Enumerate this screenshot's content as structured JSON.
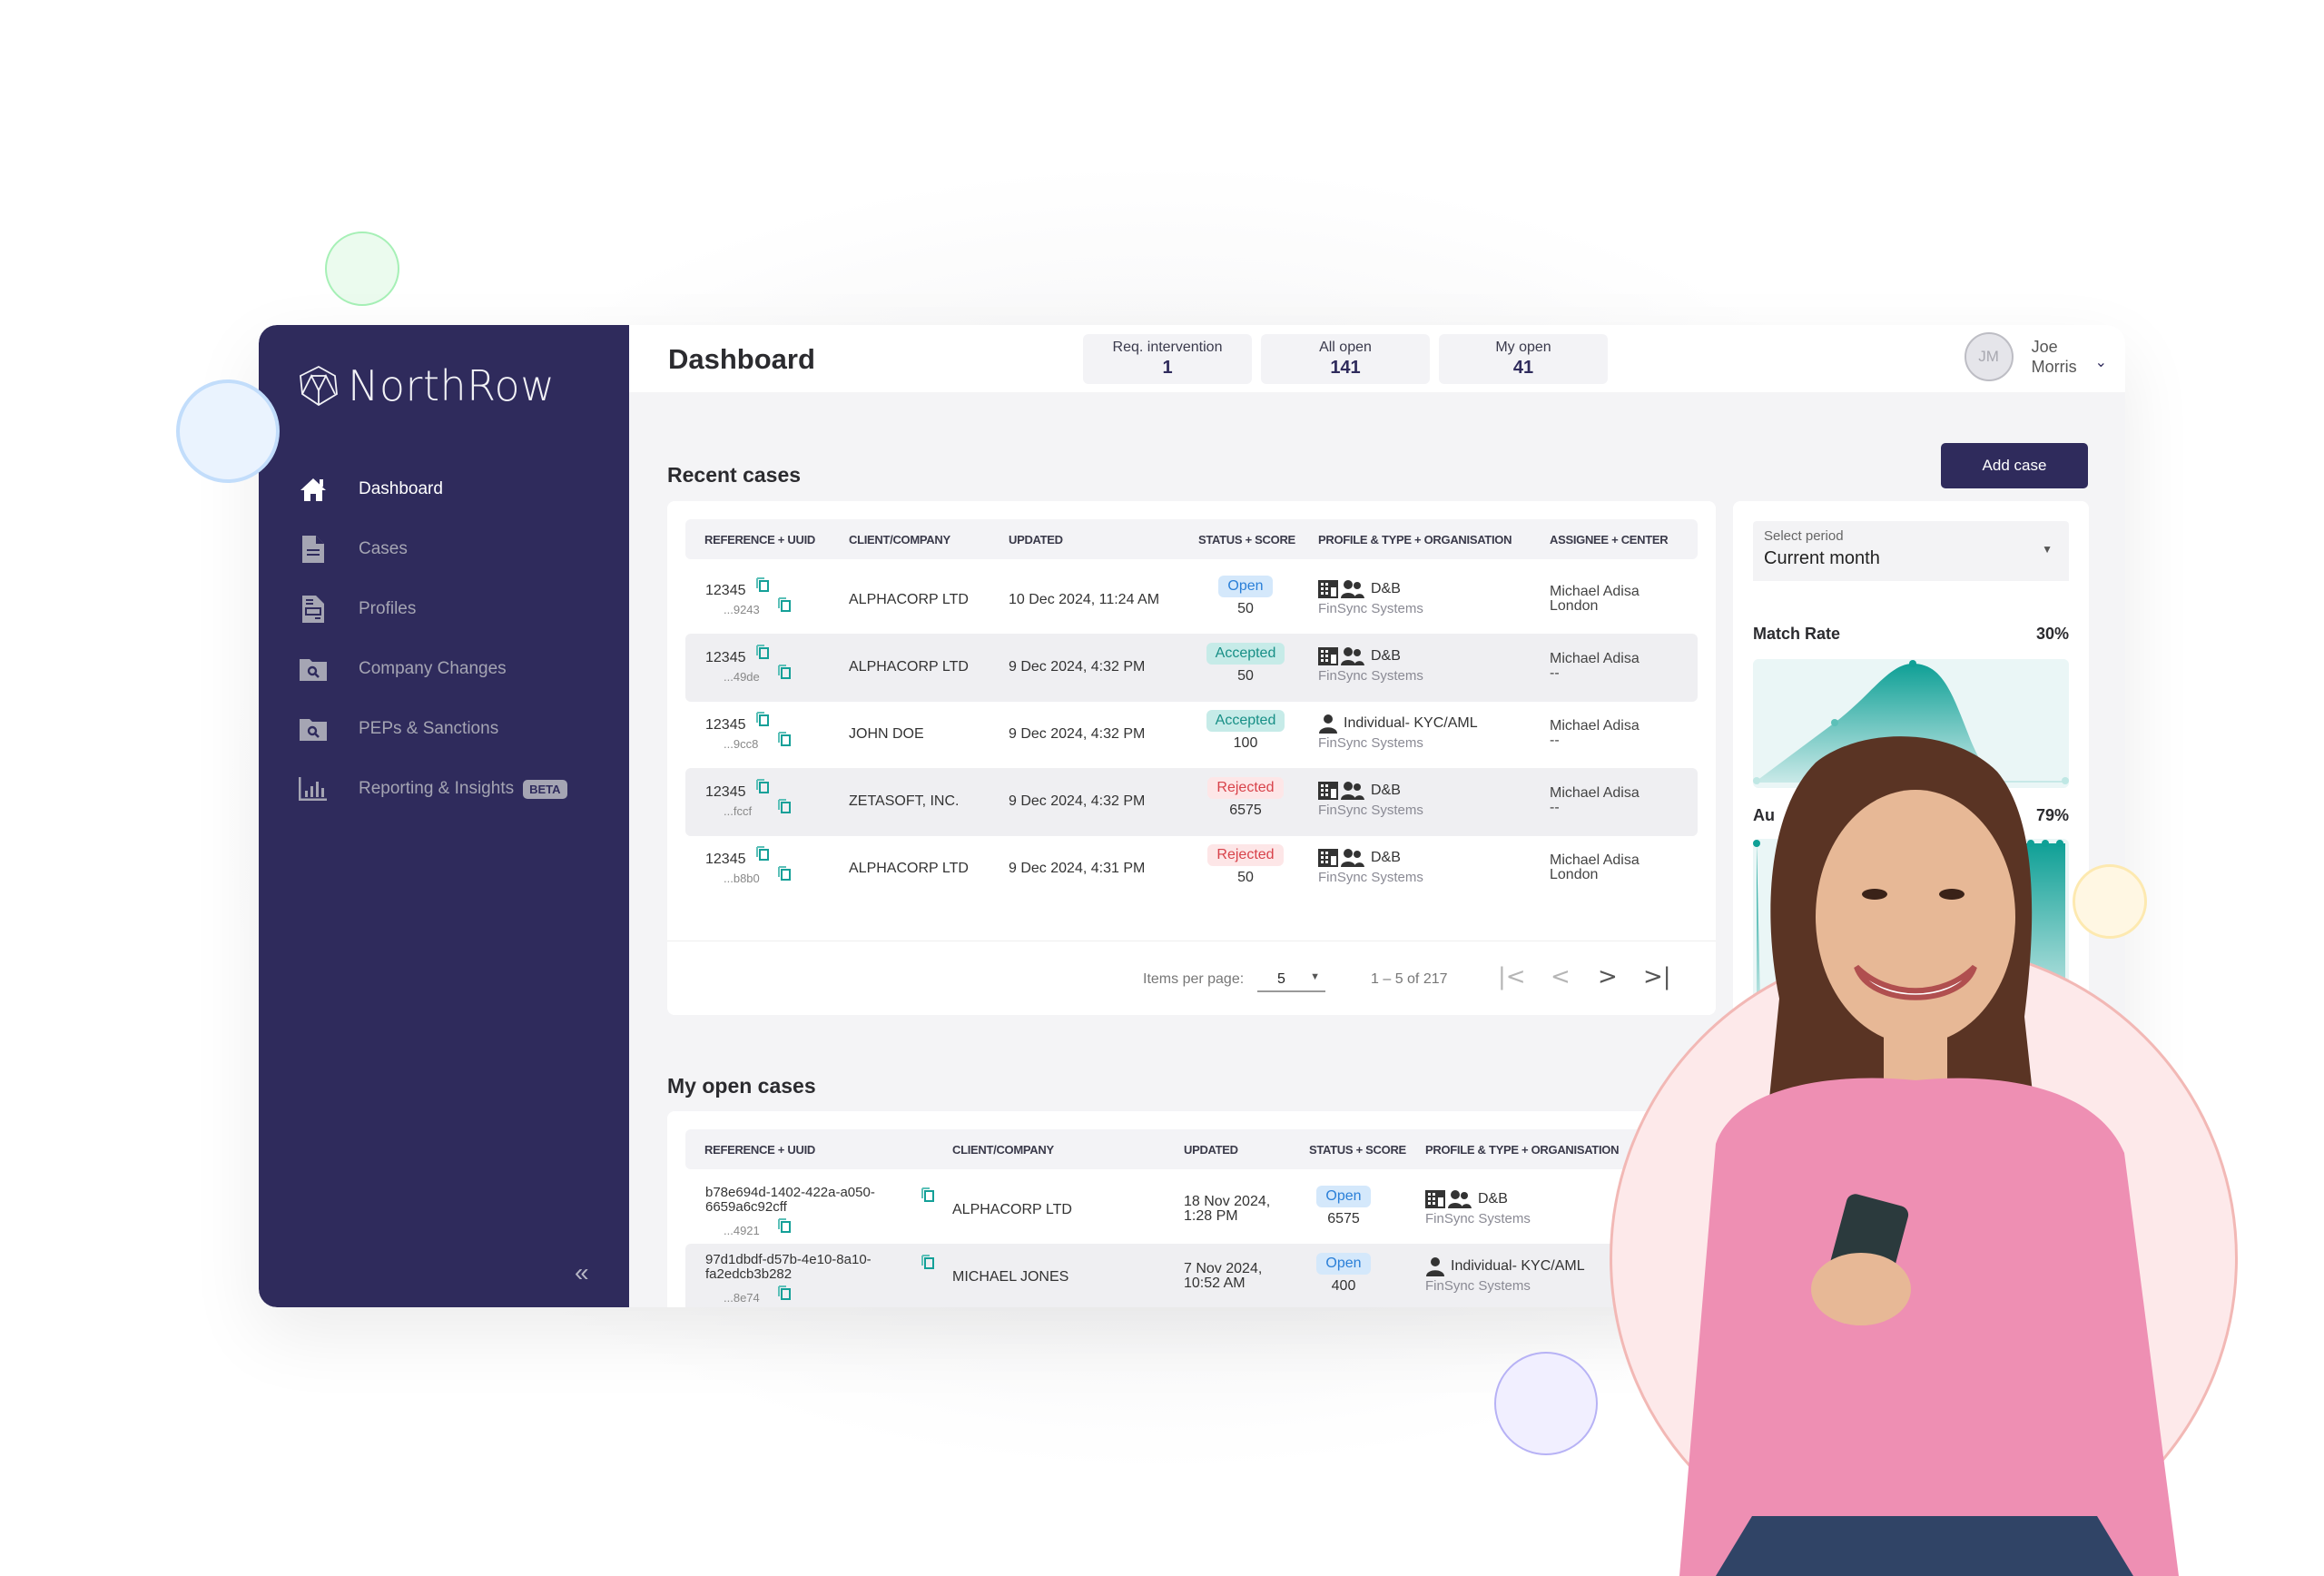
{
  "app": {
    "brand": "NorthRow",
    "page_title": "Dashboard"
  },
  "sidebar": {
    "items": [
      {
        "label": "Dashboard",
        "icon": "home-icon",
        "active": true
      },
      {
        "label": "Cases",
        "icon": "document-icon",
        "active": false
      },
      {
        "label": "Profiles",
        "icon": "profile-document-icon",
        "active": false
      },
      {
        "label": "Company Changes",
        "icon": "folder-search-icon",
        "active": false
      },
      {
        "label": "PEPs & Sanctions",
        "icon": "folder-search-icon",
        "active": false
      },
      {
        "label": "Reporting & Insights",
        "icon": "bar-chart-icon",
        "active": false,
        "badge": "BETA"
      }
    ],
    "collapse_label": "«"
  },
  "header": {
    "stats": [
      {
        "label": "Req. intervention",
        "value": "1"
      },
      {
        "label": "All open",
        "value": "141"
      },
      {
        "label": "My open",
        "value": "41"
      }
    ],
    "user": {
      "initials": "JM",
      "first_name": "Joe",
      "last_name": "Morris"
    }
  },
  "recent_cases": {
    "title": "Recent cases",
    "columns": [
      "REFERENCE + UUID",
      "CLIENT/COMPANY",
      "UPDATED",
      "STATUS + SCORE",
      "PROFILE & TYPE + ORGANISATION",
      "ASSIGNEE + CENTER"
    ],
    "rows": [
      {
        "ref": "12345",
        "uuid_short": "...9243",
        "client": "ALPHACORP LTD",
        "updated": "10 Dec 2024, 11:24 AM",
        "status": "Open",
        "status_kind": "open",
        "score": "50",
        "profile_type": "company",
        "profile": "D&B",
        "org": "FinSync Systems",
        "assignee": "Michael Adisa",
        "center": "London"
      },
      {
        "ref": "12345",
        "uuid_short": "...49de",
        "client": "ALPHACORP LTD",
        "updated": "9 Dec 2024, 4:32 PM",
        "status": "Accepted",
        "status_kind": "accepted",
        "score": "50",
        "profile_type": "company",
        "profile": "D&B",
        "org": "FinSync Systems",
        "assignee": "Michael Adisa",
        "center": "--"
      },
      {
        "ref": "12345",
        "uuid_short": "...9cc8",
        "client": "JOHN DOE",
        "updated": "9 Dec 2024, 4:32 PM",
        "status": "Accepted",
        "status_kind": "accepted",
        "score": "100",
        "profile_type": "individual",
        "profile": "Individual- KYC/AML",
        "org": "FinSync Systems",
        "assignee": "Michael Adisa",
        "center": "--"
      },
      {
        "ref": "12345",
        "uuid_short": "...fccf",
        "client": "ZETASOFT, INC.",
        "updated": "9 Dec 2024, 4:32 PM",
        "status": "Rejected",
        "status_kind": "rejected",
        "score": "6575",
        "profile_type": "company",
        "profile": "D&B",
        "org": "FinSync Systems",
        "assignee": "Michael Adisa",
        "center": "--"
      },
      {
        "ref": "12345",
        "uuid_short": "...b8b0",
        "client": "ALPHACORP LTD",
        "updated": "9 Dec 2024, 4:31 PM",
        "status": "Rejected",
        "status_kind": "rejected",
        "score": "50",
        "profile_type": "company",
        "profile": "D&B",
        "org": "FinSync Systems",
        "assignee": "Michael Adisa",
        "center": "London"
      }
    ],
    "pagination": {
      "items_per_page_label": "Items per page:",
      "items_per_page": "5",
      "range": "1 – 5 of 217"
    }
  },
  "my_open_cases": {
    "title": "My open cases",
    "columns": [
      "REFERENCE + UUID",
      "CLIENT/COMPANY",
      "UPDATED",
      "STATUS + SCORE",
      "PROFILE & TYPE + ORGANISATION"
    ],
    "rows": [
      {
        "ref": "b78e694d-1402-422a-a050-6659a6c92cff",
        "uuid_short": "...4921",
        "client": "ALPHACORP LTD",
        "updated": "18 Nov 2024, 1:28 PM",
        "status": "Open",
        "status_kind": "open",
        "score": "6575",
        "profile_type": "company",
        "profile": "D&B",
        "org": "FinSync Systems"
      },
      {
        "ref": "97d1dbdf-d57b-4e10-8a10-fa2edcb3b282",
        "uuid_short": "...8e74",
        "client": "MICHAEL JONES",
        "updated": "7 Nov 2024, 10:52 AM",
        "status": "Open",
        "status_kind": "open",
        "score": "400",
        "profile_type": "individual",
        "profile": "Individual- KYC/AML",
        "org": "FinSync Systems"
      }
    ]
  },
  "side_panel": {
    "add_case_label": "Add case",
    "period": {
      "label": "Select period",
      "value": "Current month"
    },
    "metrics": [
      {
        "label": "Match Rate",
        "value": "30%"
      },
      {
        "label": "Au",
        "value": "79%"
      }
    ]
  },
  "colors": {
    "brand": "#2f2b5c",
    "accent": "#14a098",
    "open": "#2a7fd8",
    "accepted": "#178f86",
    "rejected": "#d8424a"
  }
}
